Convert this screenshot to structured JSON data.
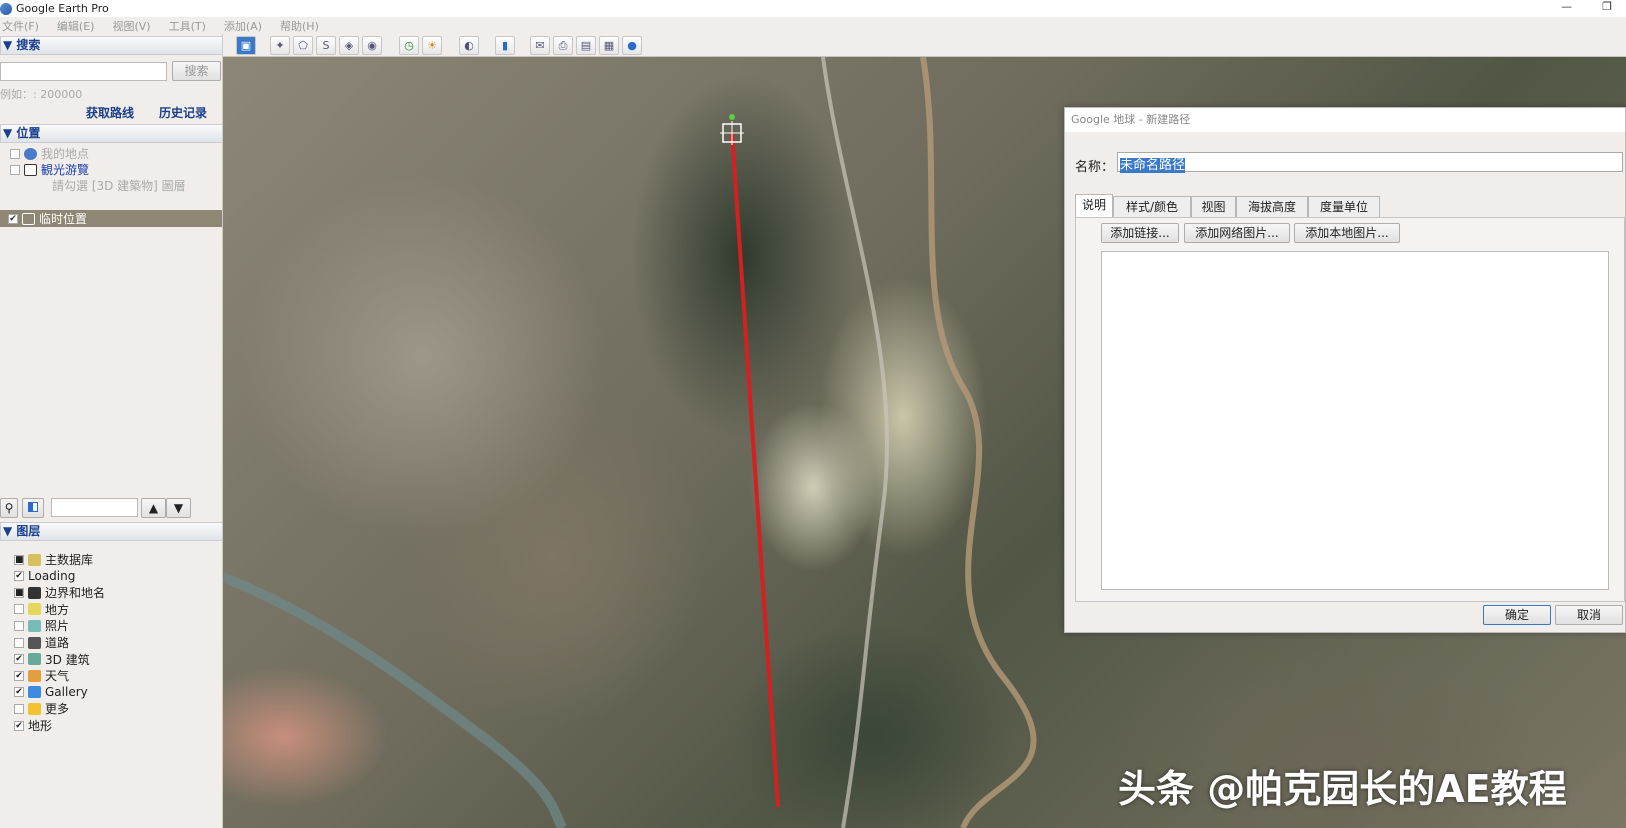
{
  "window": {
    "title": "Google Earth Pro",
    "minimize": "—",
    "restore": "❐"
  },
  "menu": [
    "文件(F)",
    "编辑(E)",
    "视图(V)",
    "工具(T)",
    "添加(A)",
    "帮助(H)"
  ],
  "search": {
    "header": "▼ 搜索",
    "button": "搜索",
    "value": "",
    "hint": "例如：: 200000",
    "directions": "获取路线",
    "history": "历史记录"
  },
  "places": {
    "header": "▼ 位置",
    "my_places": "我的地点",
    "tour": "観光游覽",
    "tour_hint": "請勾選 [3D 建築物] 圖層",
    "temp": "临时位置"
  },
  "layers": {
    "header": "▼ 图层",
    "items": [
      {
        "label": "主数据库",
        "check": "■",
        "color": "#d8c060"
      },
      {
        "label": "Loading",
        "check": "✔",
        "color": ""
      },
      {
        "label": "边界和地名",
        "check": "■",
        "color": "#333"
      },
      {
        "label": "地方",
        "check": "",
        "color": "#e6d65a"
      },
      {
        "label": "照片",
        "check": "",
        "color": "#7bb"
      },
      {
        "label": "道路",
        "check": "",
        "color": "#555"
      },
      {
        "label": "3D 建筑",
        "check": "✔",
        "color": "#6a9"
      },
      {
        "label": "天气",
        "check": "✔",
        "color": "#e0a040"
      },
      {
        "label": "Gallery",
        "check": "✔",
        "color": "#3b8be0"
      },
      {
        "label": "更多",
        "check": "",
        "color": "#f2c230"
      },
      {
        "label": "地形",
        "check": "✔",
        "color": ""
      }
    ]
  },
  "dialog": {
    "title": "Google 地球 - 新建路径",
    "name_label": "名称：",
    "name_value": "未命名路径",
    "tabs": [
      "说明",
      "样式/颜色",
      "视图",
      "海拔高度",
      "度量单位"
    ],
    "add_link": "添加链接...",
    "add_web_image": "添加网络图片...",
    "add_local_image": "添加本地图片...",
    "description": "",
    "ok": "确定",
    "cancel": "取消"
  },
  "path_color": "#d42020",
  "watermark": "头条 @帕克园长的AE教程"
}
